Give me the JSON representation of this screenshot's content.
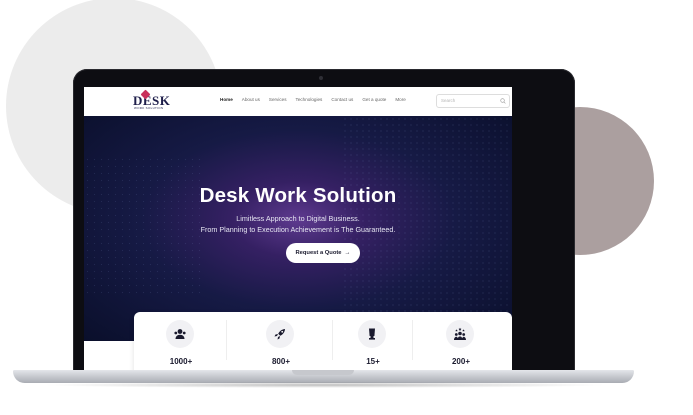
{
  "brand": {
    "logo_text": "DESK",
    "logo_sub": "WORK SOLUTION"
  },
  "nav": {
    "items": [
      {
        "label": "Home",
        "active": true
      },
      {
        "label": "About us",
        "active": false
      },
      {
        "label": "Services",
        "active": false
      },
      {
        "label": "Technologies",
        "active": false
      },
      {
        "label": "Contact us",
        "active": false
      },
      {
        "label": "Get a quote",
        "active": false
      },
      {
        "label": "More",
        "active": false
      }
    ],
    "search_placeholder": "Search"
  },
  "hero": {
    "title": "Desk Work Solution",
    "subtitle_line1": "Limitless Approach to Digital Business.",
    "subtitle_line2": "From Planning to Execution Achievement is The Guaranteed.",
    "cta_label": "Request a Quote",
    "cta_icon": "arrow-right-icon"
  },
  "stats": [
    {
      "icon": "users-icon",
      "value": "1000+"
    },
    {
      "icon": "rocket-icon",
      "value": "800+"
    },
    {
      "icon": "trophy-icon",
      "value": "15+"
    },
    {
      "icon": "team-stars-icon",
      "value": "200+"
    }
  ],
  "colors": {
    "accent": "#c9305a",
    "hero_dark": "#0a0f2b",
    "hero_glow": "#5e3a8f",
    "deco_left": "#ececec",
    "deco_right": "#ab9f9f"
  }
}
